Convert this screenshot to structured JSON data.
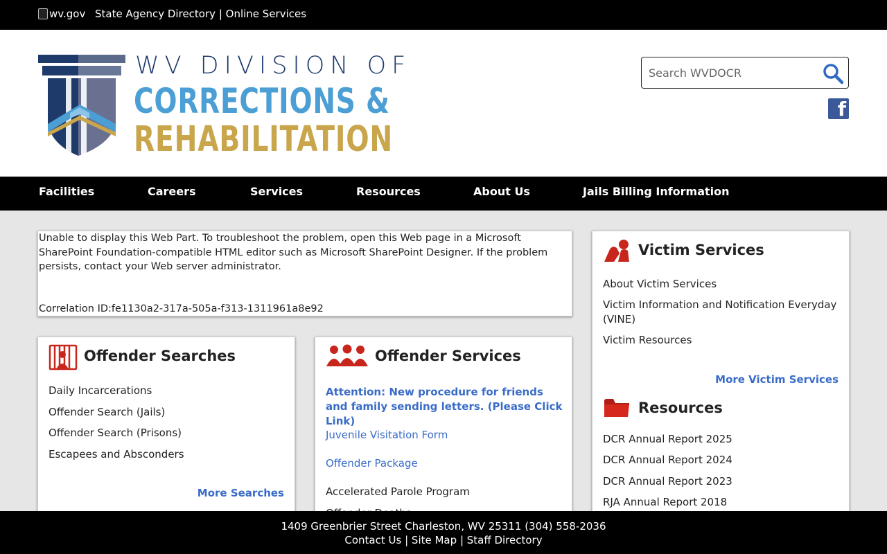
{
  "topbar": {
    "wvgov_alt": "wv.gov",
    "agency_directory": "State Agency Directory",
    "separator": "|",
    "online_services": "Online Services"
  },
  "logo": {
    "line1": "WV DIVISION OF",
    "line2": "CORRECTIONS &",
    "line3": "REHABILITATION"
  },
  "search": {
    "placeholder": "Search WVDOCR",
    "icon": "search-icon"
  },
  "social": {
    "facebook_icon": "facebook-icon"
  },
  "nav": {
    "items": [
      {
        "label": "Facilities"
      },
      {
        "label": "Careers"
      },
      {
        "label": "Services"
      },
      {
        "label": "Resources"
      },
      {
        "label": "About Us"
      },
      {
        "label": "Jails Billing Information"
      }
    ]
  },
  "error_part": {
    "message": "Unable to display this Web Part. To troubleshoot the problem, open this Web page in a Microsoft SharePoint Foundation-compatible HTML editor such as Microsoft SharePoint Designer. If the problem persists, contact your Web server administrator.",
    "correlation": "Correlation ID:fe1130a2-317a-505a-f313-1311961a8e92"
  },
  "offender_searches": {
    "title": "Offender Searches",
    "icon": "jail-bars-icon",
    "links": [
      "Daily Incarcerations",
      "Offender Search (Jails)",
      "Offender Search (Prisons)",
      "Escapees and Absconders"
    ],
    "more": "More Searches"
  },
  "offender_services": {
    "title": "Offender Services",
    "icon": "people-group-icon",
    "attention": "Attention: New procedure for friends and family sending letters. (Please Click Link)",
    "links": [
      "Juvenile Visitation Form",
      "Offender Package",
      "Accelerated Parole Program",
      "Offender Deaths"
    ]
  },
  "victim_services": {
    "title": "Victim Services",
    "icon": "victim-icon",
    "links": [
      "About Victim Services",
      "Victim Information and Notification Everyday (VINE)",
      "Victim Resources"
    ],
    "more": "More Victim Services"
  },
  "resources": {
    "title": "Resources",
    "icon": "folder-icon",
    "links": [
      "DCR Annual Report 2025",
      "DCR Annual Report 2024",
      "DCR Annual Report 2023",
      "RJA Annual Report 2018"
    ]
  },
  "footer": {
    "address": "1409 Greenbrier Street Charleston, WV 25311 (304) 558-2036",
    "contact": "Contact Us",
    "sitemap": "Site Map",
    "staff": "Staff Directory",
    "sep": "|"
  },
  "colors": {
    "brand_navy": "#1d3a6b",
    "brand_blue": "#4b9fd5",
    "brand_gold": "#c9a64c",
    "link_blue": "#3a6cc7",
    "icon_red": "#c8261c"
  }
}
